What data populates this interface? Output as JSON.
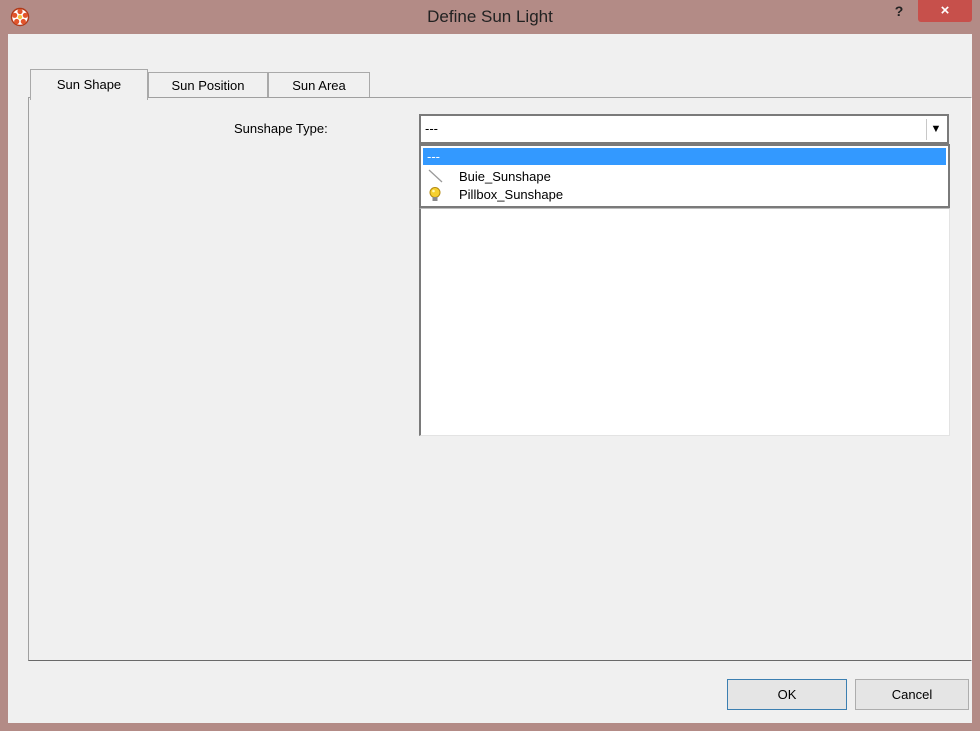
{
  "window": {
    "title": "Define Sun Light",
    "help_label": "?",
    "close_label": "×"
  },
  "tabs": [
    {
      "label": "Sun Shape",
      "active": true
    },
    {
      "label": "Sun Position",
      "active": false
    },
    {
      "label": "Sun Area",
      "active": false
    }
  ],
  "form": {
    "sunshape_label": "Sunshape Type:",
    "sunshape_value": "---",
    "options": [
      {
        "label": "---",
        "selected": true,
        "icon": ""
      },
      {
        "label": "Buie_Sunshape",
        "selected": false,
        "icon": "line-icon"
      },
      {
        "label": "Pillbox_Sunshape",
        "selected": false,
        "icon": "lightbulb-icon"
      }
    ]
  },
  "buttons": {
    "ok": "OK",
    "cancel": "Cancel"
  },
  "colors": {
    "titlebar": "#b38b86",
    "close": "#c7504b",
    "selection": "#3399ff",
    "face": "#f0f0f0"
  }
}
